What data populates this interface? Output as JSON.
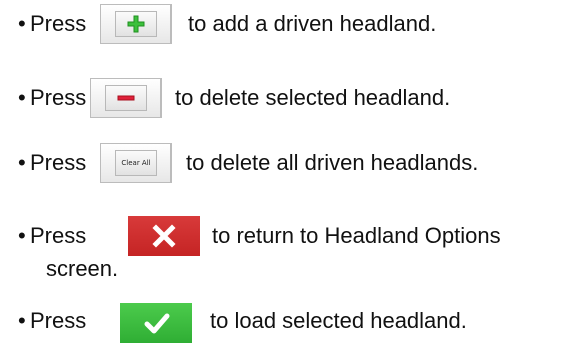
{
  "bullets": [
    {
      "bullet": "•",
      "press": "Press",
      "text": "to add a driven headland.",
      "button": {
        "icon": "plus-icon",
        "color": "#3cc03c"
      }
    },
    {
      "bullet": "•",
      "press": "Press",
      "text": "to delete selected headland.",
      "button": {
        "icon": "minus-icon",
        "color": "#e0203a"
      }
    },
    {
      "bullet": "•",
      "press": "Press",
      "text": "to delete all driven headlands.",
      "button": {
        "label": "Clear All"
      }
    },
    {
      "bullet": "•",
      "press": "Press",
      "text": "to return to Headland Options",
      "text_continued": "screen.",
      "button": {
        "icon": "close-x-icon",
        "color": "#d02f2f"
      }
    },
    {
      "bullet": "•",
      "press": "Press",
      "text": "to load selected headland.",
      "button": {
        "icon": "checkmark-icon",
        "color": "#3cbc3c"
      }
    }
  ]
}
